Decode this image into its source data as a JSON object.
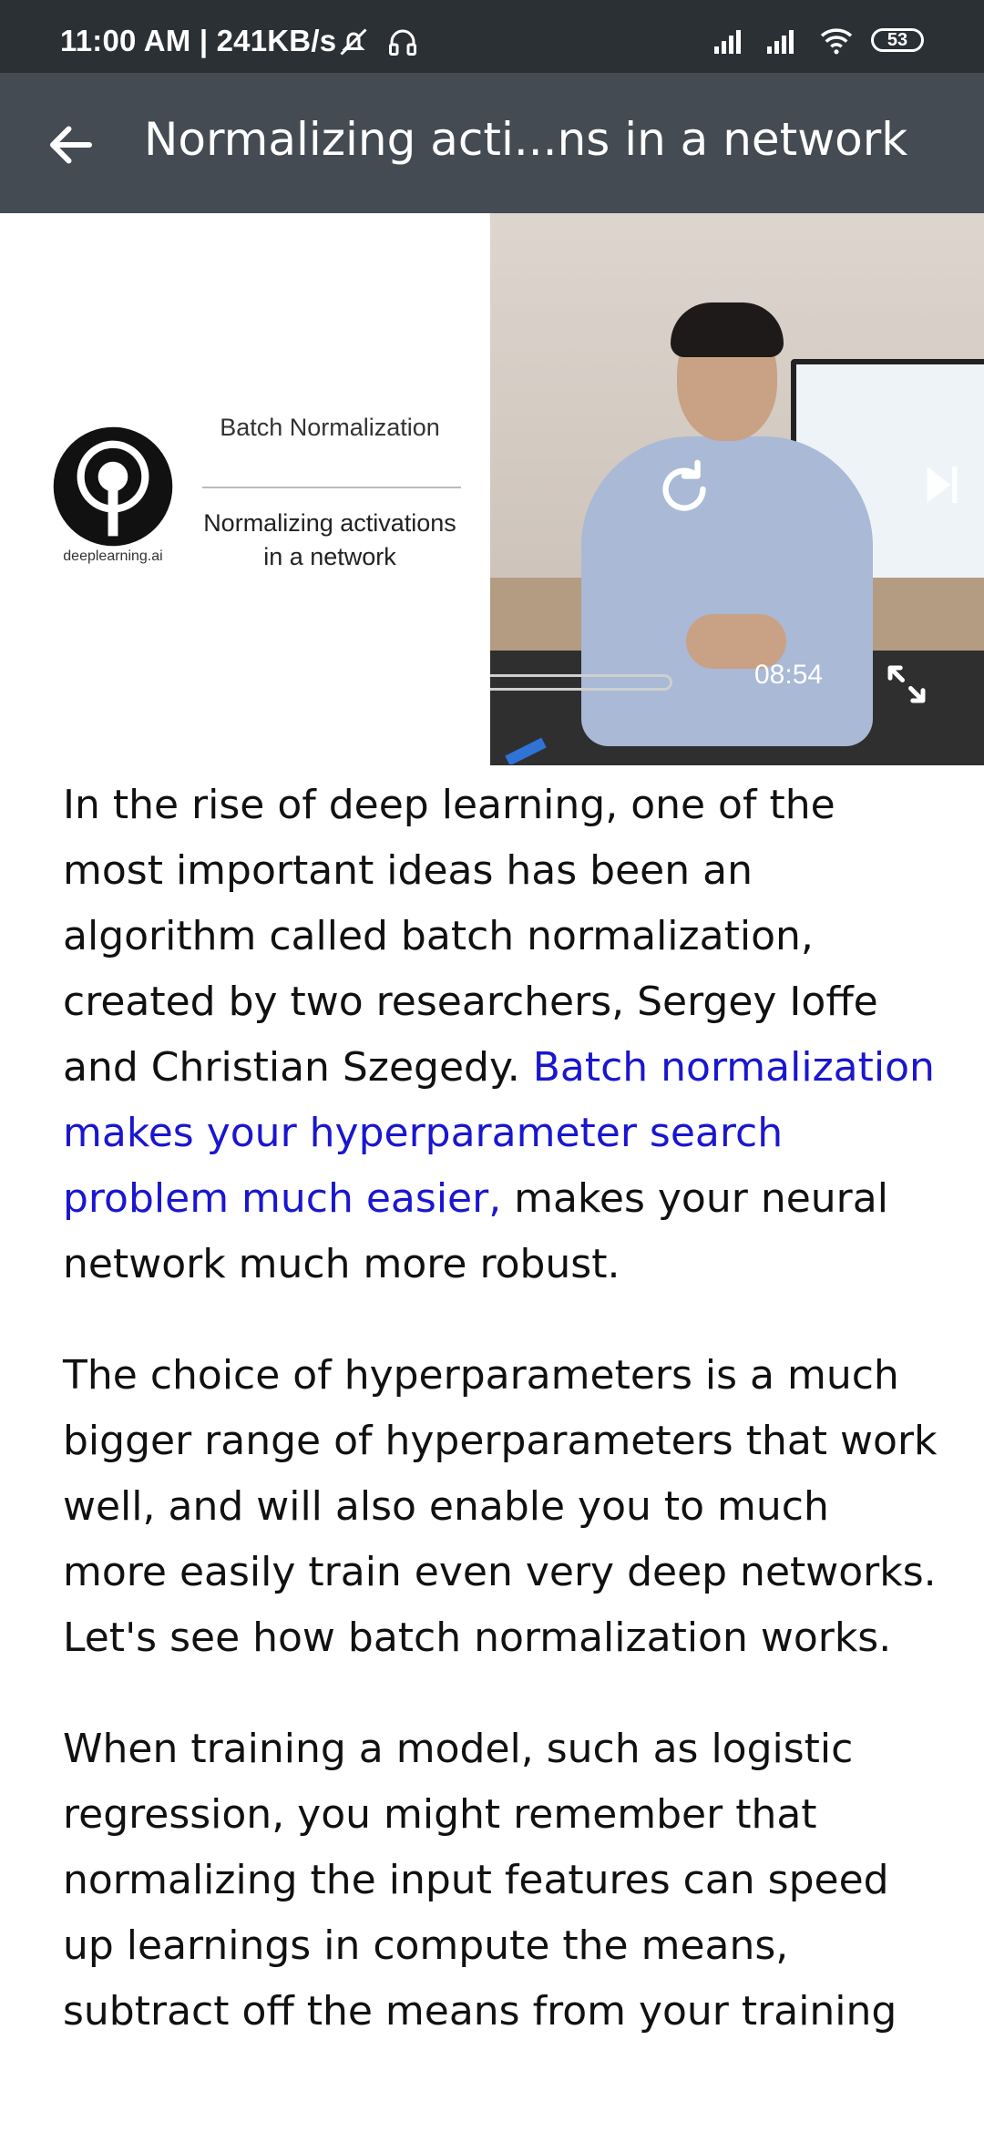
{
  "status_bar": {
    "time": "11:00 AM | 241KB/s",
    "battery": "53",
    "icons": [
      "mute-bell-icon",
      "headphones-icon",
      "signal-icon",
      "signal-icon",
      "wifi-icon",
      "battery-icon"
    ]
  },
  "app_bar": {
    "title": "Normalizing acti...ns in a network",
    "back_icon": "back-arrow-icon"
  },
  "slide": {
    "logo_caption": "deeplearning.ai",
    "heading": "Batch Normalization",
    "subheading": "Normalizing activations in a network"
  },
  "video": {
    "duration": "08:54",
    "progress_fraction": 0.4
  },
  "transcript": {
    "p1_before": "In the rise of deep learning, one of the most important ideas has been an algorithm called batch normalization, created by two researchers, Sergey Ioffe and Christian Szegedy. ",
    "p1_link": "Batch normalization makes your hyperparameter search problem much easier,",
    "p1_after": " makes your neural network much more robust.",
    "p2": "The choice of hyperparameters is a much bigger range of hyperparameters that work well, and will also enable you to much more easily train even very deep networks. Let's see how batch normalization works.",
    "p3": "When training a model, such as logistic regression, you might remember that normalizing the input features can speed up learnings in compute the means, subtract off the means from your training"
  },
  "colors": {
    "status_bg": "#2b3035",
    "appbar_bg": "#454b53",
    "link": "#1a16cf"
  }
}
